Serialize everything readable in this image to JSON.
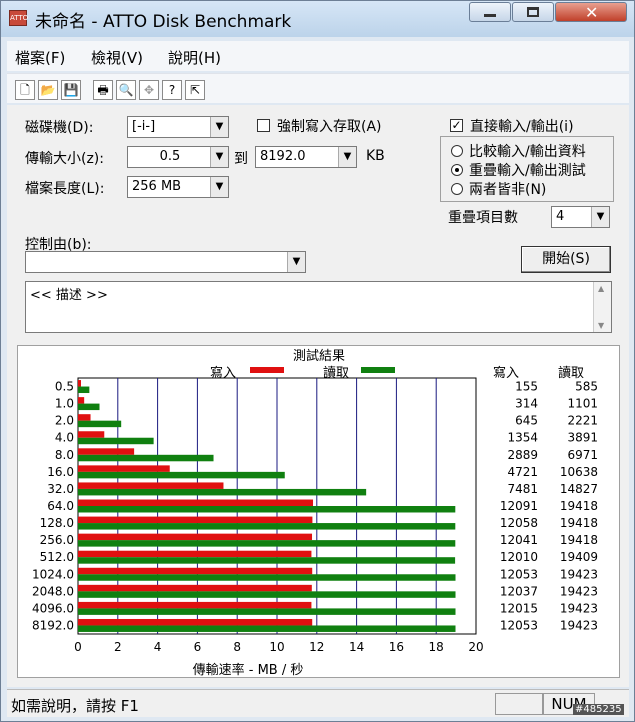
{
  "window": {
    "title": "未命名 - ATTO Disk Benchmark",
    "app_icon_text": "ATTO"
  },
  "menu": {
    "items": [
      "檔案(F)",
      "檢視(V)",
      "說明(H)"
    ]
  },
  "form": {
    "drive_label": "磁碟機(D):",
    "drive_value": "[-i-]",
    "force_write_label": "強制寫入存取(A)",
    "force_write_checked": false,
    "direct_io_label": "直接輸入/輸出(i)",
    "direct_io_checked": true,
    "transfer_label": "傳輸大小(z):",
    "transfer_from": "0.5",
    "to_label": "到",
    "transfer_to": "8192.0",
    "kb_label": "KB",
    "length_label": "檔案長度(L):",
    "length_value": "256 MB",
    "radio_compare": "比較輸入/輸出資料",
    "radio_overlap": "重疊輸入/輸出測試",
    "radio_neither": "兩者皆非(N)",
    "selected_radio": "overlap",
    "queue_label": "重疊項目數",
    "queue_value": "4",
    "control_label": "控制由(b):",
    "control_value": "",
    "start_button": "開始(S)",
    "description": "<< 描述 >>"
  },
  "results": {
    "title": "測試結果",
    "legend_write": "寫入",
    "legend_read": "讀取",
    "col_write": "寫入",
    "col_read": "讀取",
    "write_color": "#e01010",
    "read_color": "#108010",
    "xlabel": "傳輸速率 - MB / 秒"
  },
  "chart_data": {
    "type": "bar",
    "title": "測試結果",
    "xlabel": "傳輸速率 - MB / 秒",
    "ylabel": "",
    "xlim": [
      0,
      20
    ],
    "xticks": [
      "0",
      "2",
      "4",
      "6",
      "8",
      "10",
      "12",
      "14",
      "16",
      "18",
      "20"
    ],
    "categories": [
      "0.5",
      "1.0",
      "2.0",
      "4.0",
      "8.0",
      "16.0",
      "32.0",
      "64.0",
      "128.0",
      "256.0",
      "512.0",
      "1024.0",
      "2048.0",
      "4096.0",
      "8192.0"
    ],
    "series": [
      {
        "name": "寫入",
        "values": [
          0.15,
          0.31,
          0.63,
          1.32,
          2.82,
          4.61,
          7.31,
          11.81,
          11.78,
          11.76,
          11.73,
          11.77,
          11.75,
          11.73,
          11.77
        ],
        "labels": [
          "155",
          "314",
          "645",
          "1354",
          "2889",
          "4721",
          "7481",
          "12091",
          "12058",
          "12041",
          "12010",
          "12053",
          "12037",
          "12015",
          "12053"
        ]
      },
      {
        "name": "讀取",
        "values": [
          0.57,
          1.08,
          2.17,
          3.8,
          6.81,
          10.39,
          14.48,
          18.96,
          18.96,
          18.96,
          18.95,
          18.97,
          18.97,
          18.97,
          18.97
        ],
        "labels": [
          "585",
          "1101",
          "2221",
          "3891",
          "6971",
          "10638",
          "14827",
          "19418",
          "19418",
          "19418",
          "19409",
          "19423",
          "19423",
          "19423",
          "19423"
        ]
      }
    ]
  },
  "status": {
    "help_text": "如需說明，請按 F1",
    "num_indicator": "NUM",
    "watermark": "#485235"
  }
}
